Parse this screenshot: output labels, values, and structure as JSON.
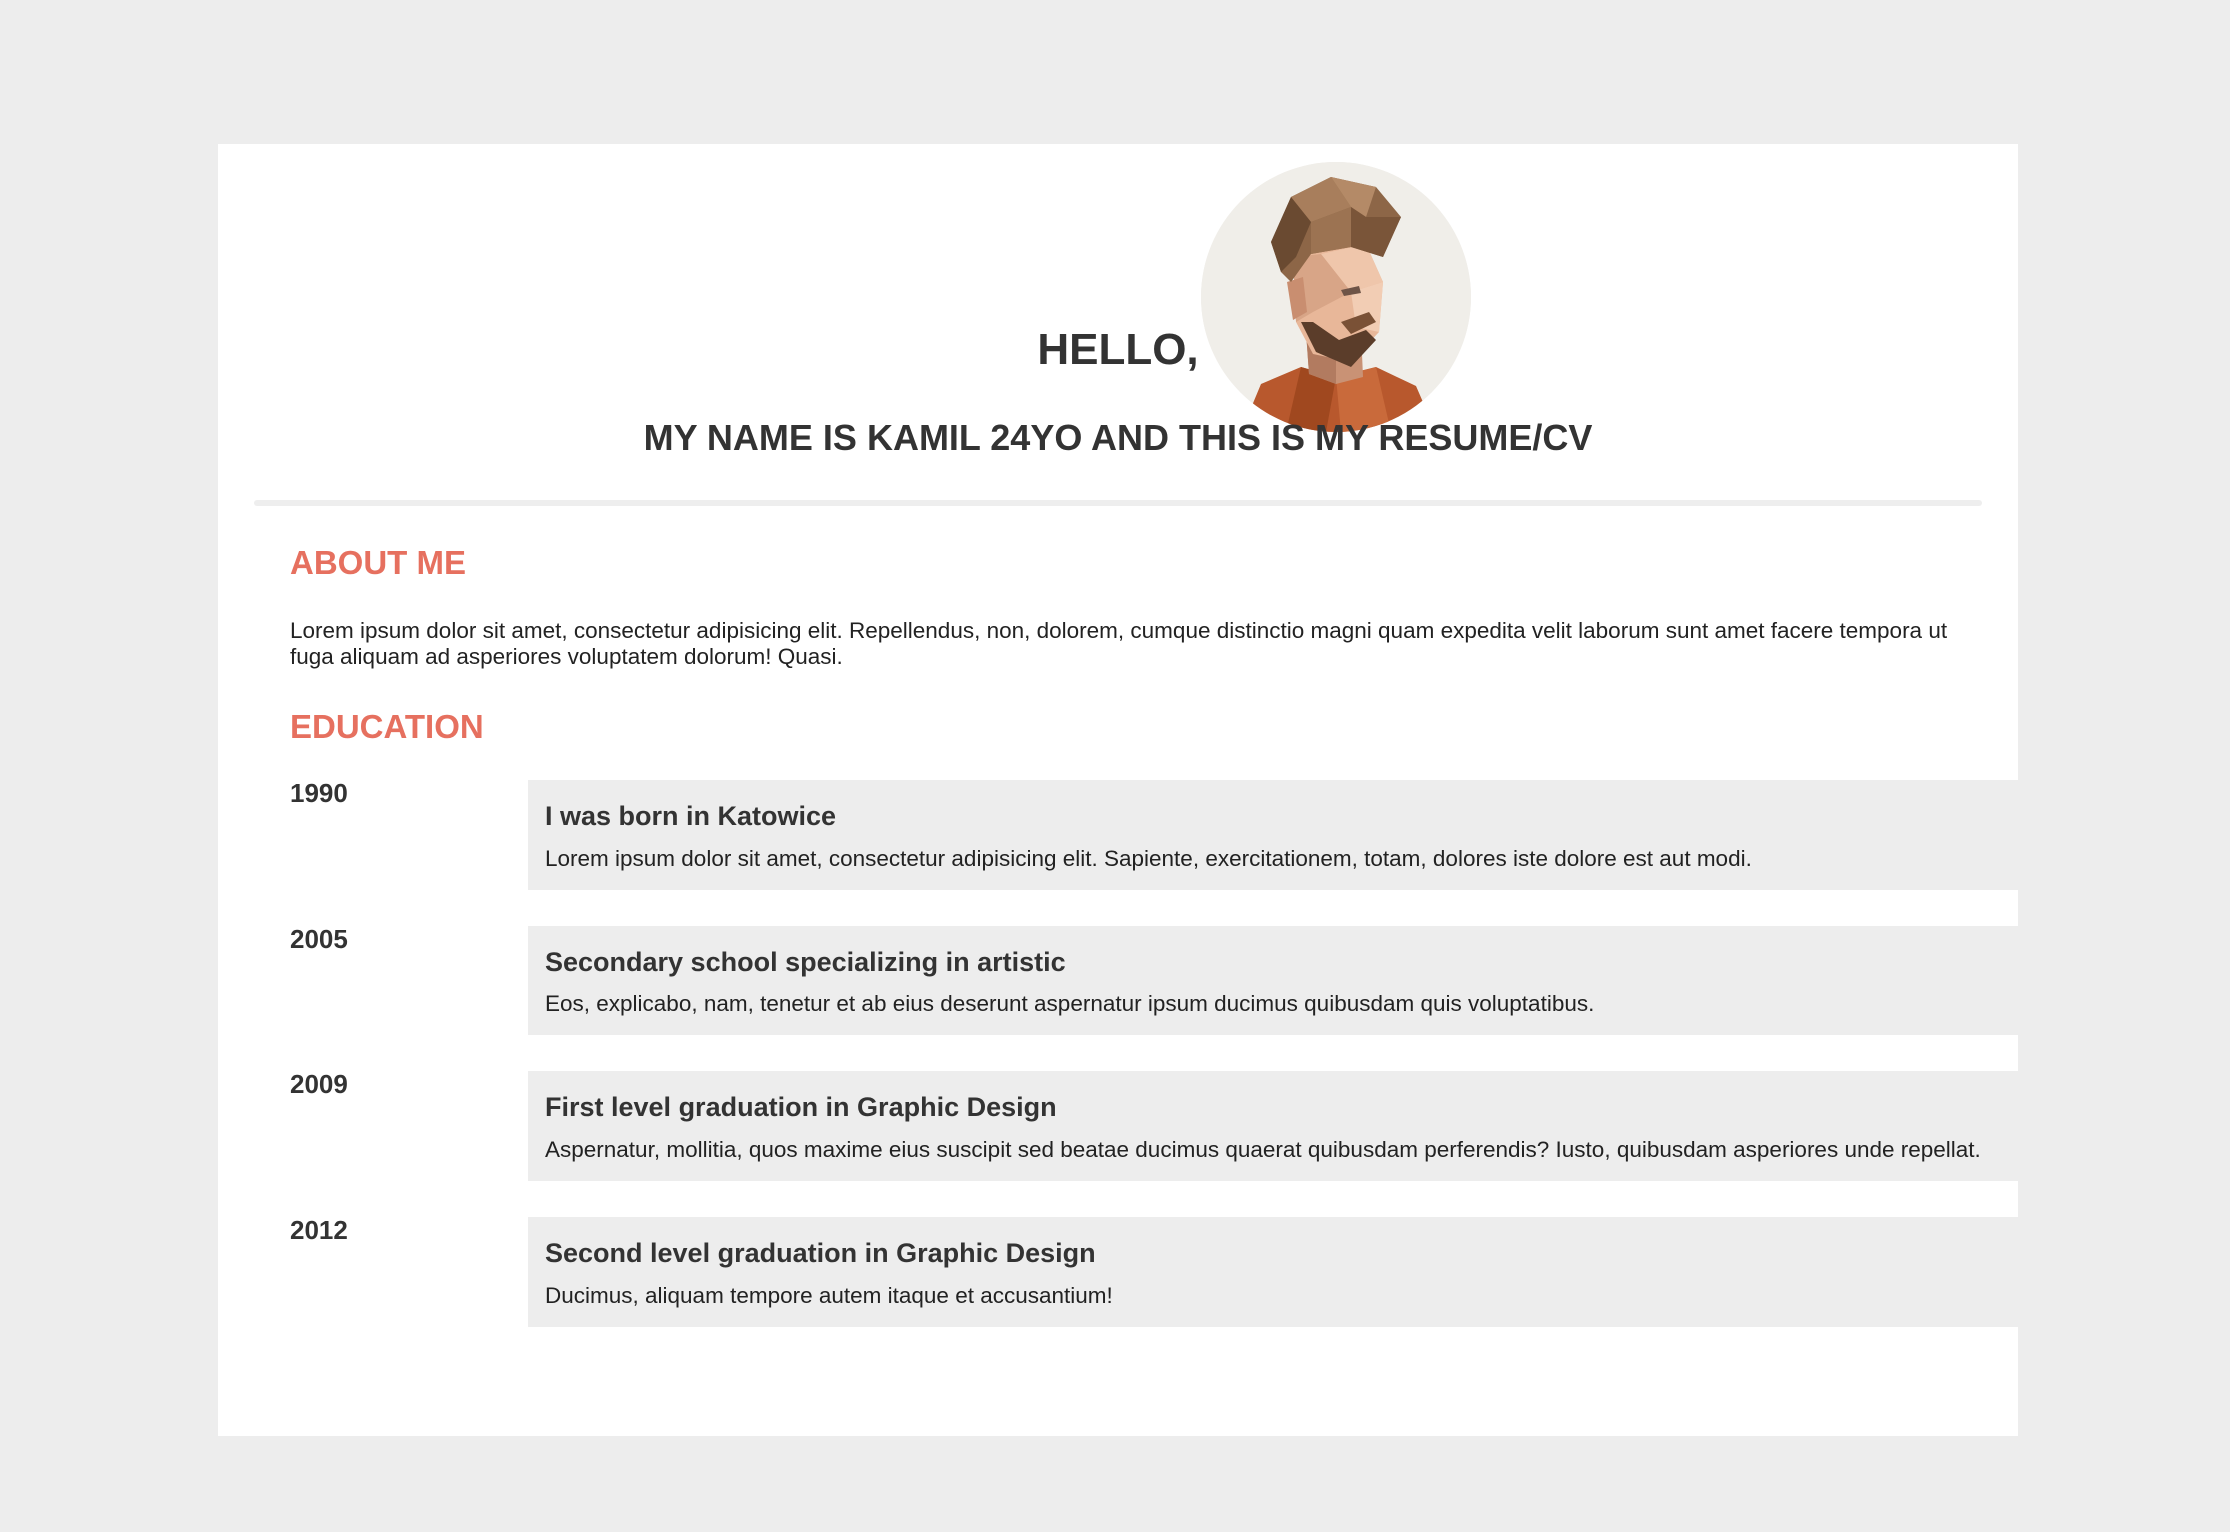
{
  "header": {
    "greeting": "HELLO,",
    "subtitle": "MY NAME IS KAMIL 24YO AND THIS IS MY RESUME/CV",
    "avatar_alt": "low-poly portrait"
  },
  "about": {
    "title": "ABOUT ME",
    "text": "Lorem ipsum dolor sit amet, consectetur adipisicing elit. Repellendus, non, dolorem, cumque distinctio magni quam expedita velit laborum sunt amet facere tempora ut fuga aliquam ad asperiores voluptatem dolorum! Quasi."
  },
  "education": {
    "title": "EDUCATION",
    "items": [
      {
        "year": "1990",
        "heading": "I was born in Katowice",
        "text": "Lorem ipsum dolor sit amet, consectetur adipisicing elit. Sapiente, exercitationem, totam, dolores iste dolore est aut modi."
      },
      {
        "year": "2005",
        "heading": "Secondary school specializing in artistic",
        "text": "Eos, explicabo, nam, tenetur et ab eius deserunt aspernatur ipsum ducimus quibusdam quis voluptatibus."
      },
      {
        "year": "2009",
        "heading": "First level graduation in Graphic Design",
        "text": "Aspernatur, mollitia, quos maxime eius suscipit sed beatae ducimus quaerat quibusdam perferendis? Iusto, quibusdam asperiores unde repellat."
      },
      {
        "year": "2012",
        "heading": "Second level graduation in Graphic Design",
        "text": "Ducimus, aliquam tempore autem itaque et accusantium!"
      }
    ]
  },
  "colors": {
    "accent": "#e6705f",
    "page_background": "#ededed",
    "card_background": "#ffffff",
    "text": "#333333"
  }
}
